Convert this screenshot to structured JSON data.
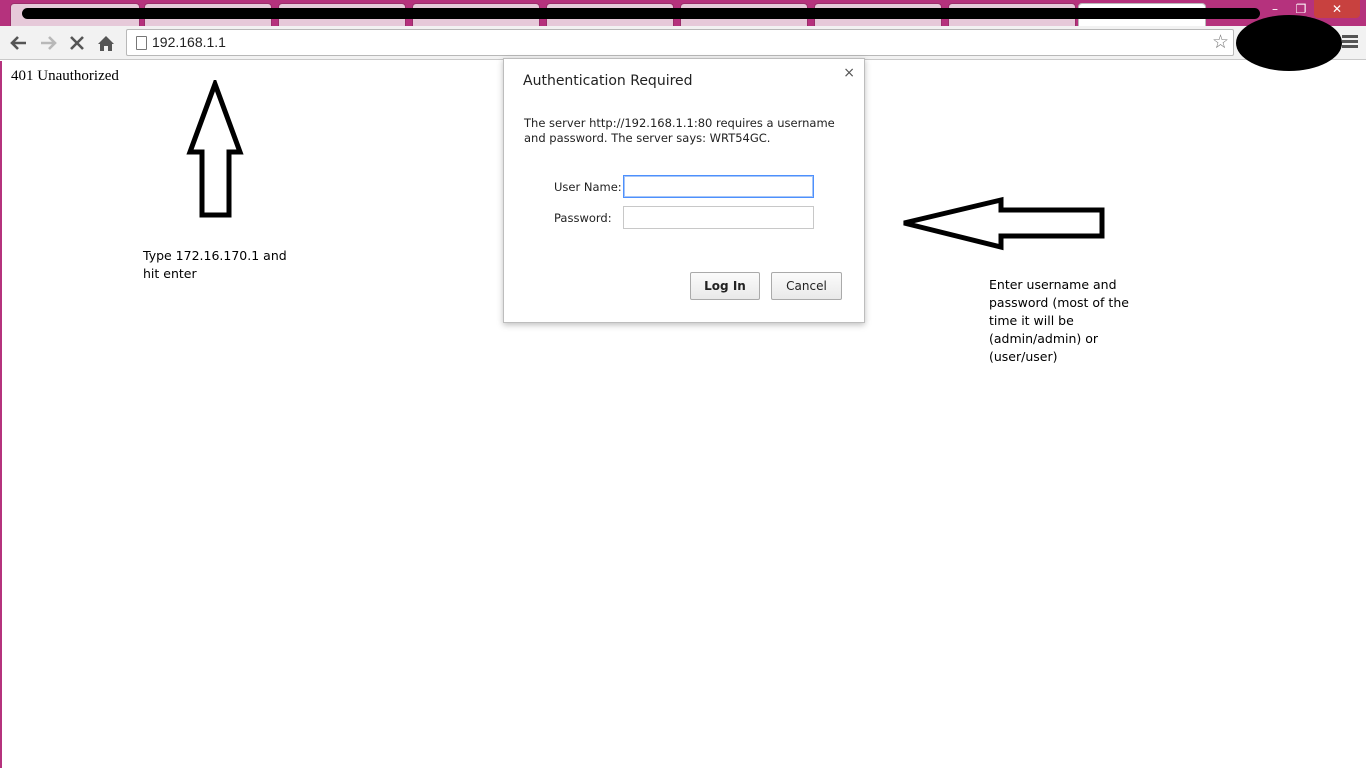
{
  "window": {
    "controls": {
      "minimize": "–",
      "maximize": "❐",
      "close": "✕"
    }
  },
  "toolbar": {
    "back_icon": "back-arrow-icon",
    "forward_icon": "forward-arrow-icon",
    "stop_icon": "stop-loading-icon",
    "home_icon": "home-icon",
    "url": "192.168.1.1",
    "bookmark_icon": "star-icon",
    "menu_icon": "hamburger-menu-icon"
  },
  "page": {
    "heading": "401 Unauthorized"
  },
  "annotations": {
    "type_instruction": "Type 172.16.170.1 and hit enter",
    "enter_instruction": "Enter username and password (most of the time it will be (admin/admin) or (user/user)"
  },
  "dialog": {
    "title": "Authentication Required",
    "close": "×",
    "message": "The server http://192.168.1.1:80 requires a username and password. The server says: WRT54GC.",
    "username_label": "User Name:",
    "username_value": "",
    "password_label": "Password:",
    "password_value": "",
    "login_button": "Log In",
    "cancel_button": "Cancel"
  },
  "colors": {
    "frame": "#b5327d",
    "focus_ring": "#4d90fe",
    "close_button": "#c8413f"
  }
}
